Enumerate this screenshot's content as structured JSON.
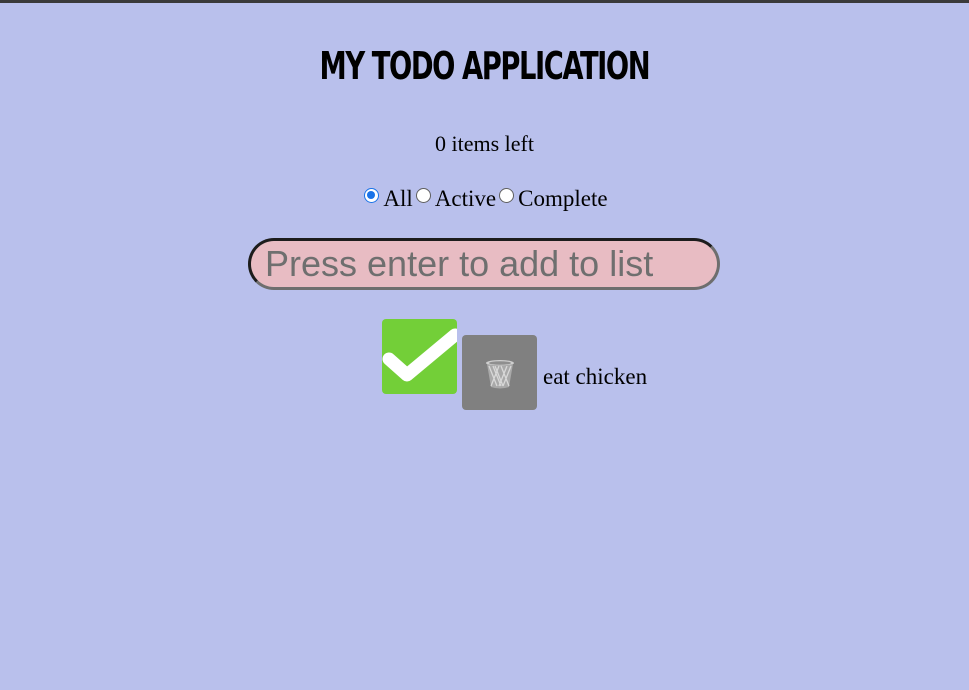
{
  "app": {
    "title": "MY TODO APPLICATION",
    "items_left": "0 items left"
  },
  "filters": {
    "options": [
      "All",
      "Active",
      "Complete"
    ],
    "selected": "All"
  },
  "input": {
    "placeholder": "Press enter to add to list",
    "value": ""
  },
  "todos": [
    {
      "text": "eat chicken",
      "completed": true,
      "check_icon": "checkmark-icon",
      "delete_icon": "trash-icon"
    }
  ],
  "colors": {
    "background": "#b9c0ec",
    "input_background": "#e8bcc3",
    "check_button": "#73cf38",
    "delete_button": "#808080",
    "radio_selected": "#1a73e8"
  }
}
